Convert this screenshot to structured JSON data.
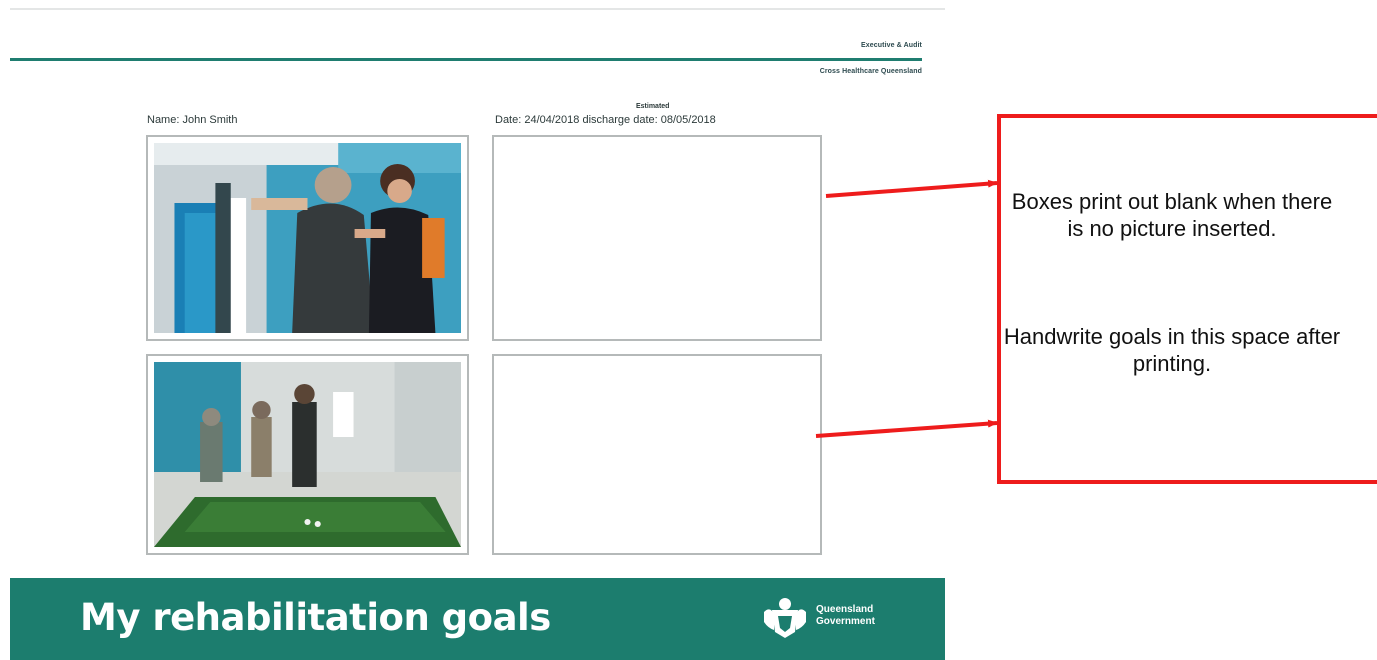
{
  "document": {
    "header_line_1": "Executive & Audit",
    "header_line_2": "Cross Healthcare Queensland",
    "name_field": "Name: John Smith",
    "date_field": "Date: 24/04/2018  discharge date: 08/05/2018",
    "estimated_label": "Estimated",
    "banner_title": "My rehabilitation goals",
    "gov_name_1": "Queensland",
    "gov_name_2": "Government"
  },
  "callout": {
    "text_1": "Boxes print out blank when there is no picture inserted.",
    "text_2": "Handwrite goals in this space after printing."
  },
  "colors": {
    "banner": "#1c7d6e",
    "rule": "#1f7d70",
    "callout_border": "#ee1c1c",
    "arrow": "#ee1c1c"
  },
  "icons": {
    "crest": "queensland-crest-icon"
  }
}
